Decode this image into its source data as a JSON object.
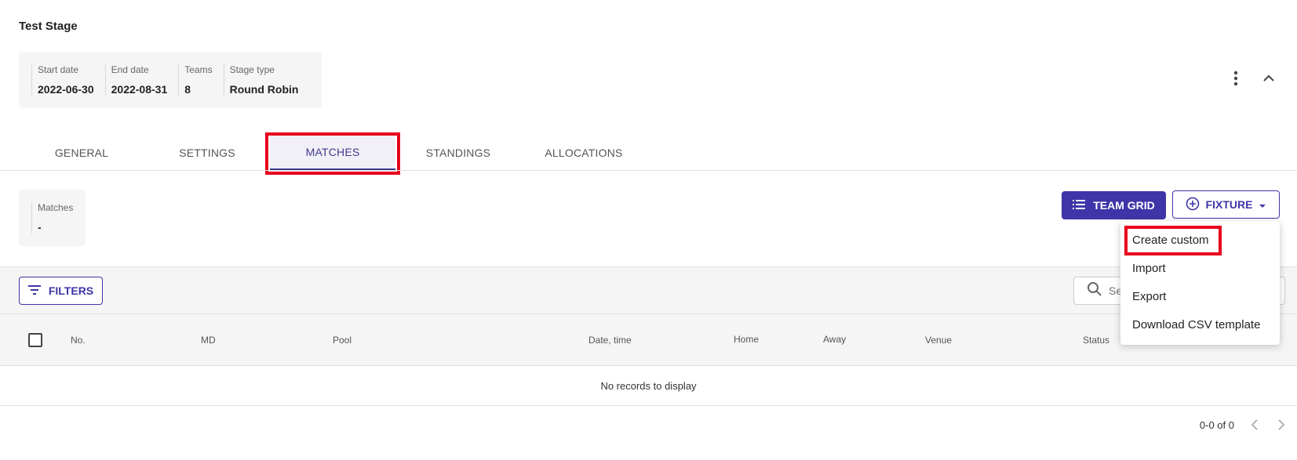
{
  "stage": {
    "title": "Test Stage",
    "info": [
      {
        "label": "Start date",
        "value": "2022-06-30"
      },
      {
        "label": "End date",
        "value": "2022-08-31"
      },
      {
        "label": "Teams",
        "value": "8"
      },
      {
        "label": "Stage type",
        "value": "Round Robin"
      }
    ]
  },
  "header_actions": {
    "more_icon": "more-vert-icon",
    "collapse_icon": "chevron-up-icon"
  },
  "tabs": [
    {
      "label": "GENERAL"
    },
    {
      "label": "SETTINGS"
    },
    {
      "label": "MATCHES",
      "active": true
    },
    {
      "label": "STANDINGS"
    },
    {
      "label": "ALLOCATIONS"
    }
  ],
  "summary": {
    "label": "Matches",
    "value": "-"
  },
  "buttons": {
    "team_grid": "TEAM GRID",
    "fixture": "FIXTURE",
    "filters": "FILTERS"
  },
  "fixture_menu": [
    {
      "label": "Create custom"
    },
    {
      "label": "Import"
    },
    {
      "label": "Export"
    },
    {
      "label": "Download CSV template"
    }
  ],
  "search": {
    "placeholder": "Search"
  },
  "table": {
    "columns": [
      "No.",
      "MD",
      "Pool",
      "Date, time",
      "Home",
      "Away",
      "Venue",
      "Status"
    ],
    "empty_text": "No records to display"
  },
  "pagination": {
    "range": "0-0 of 0"
  },
  "colors": {
    "primary": "#3f35a8",
    "highlight": "#e8001c",
    "panel": "#f5f5f5"
  }
}
